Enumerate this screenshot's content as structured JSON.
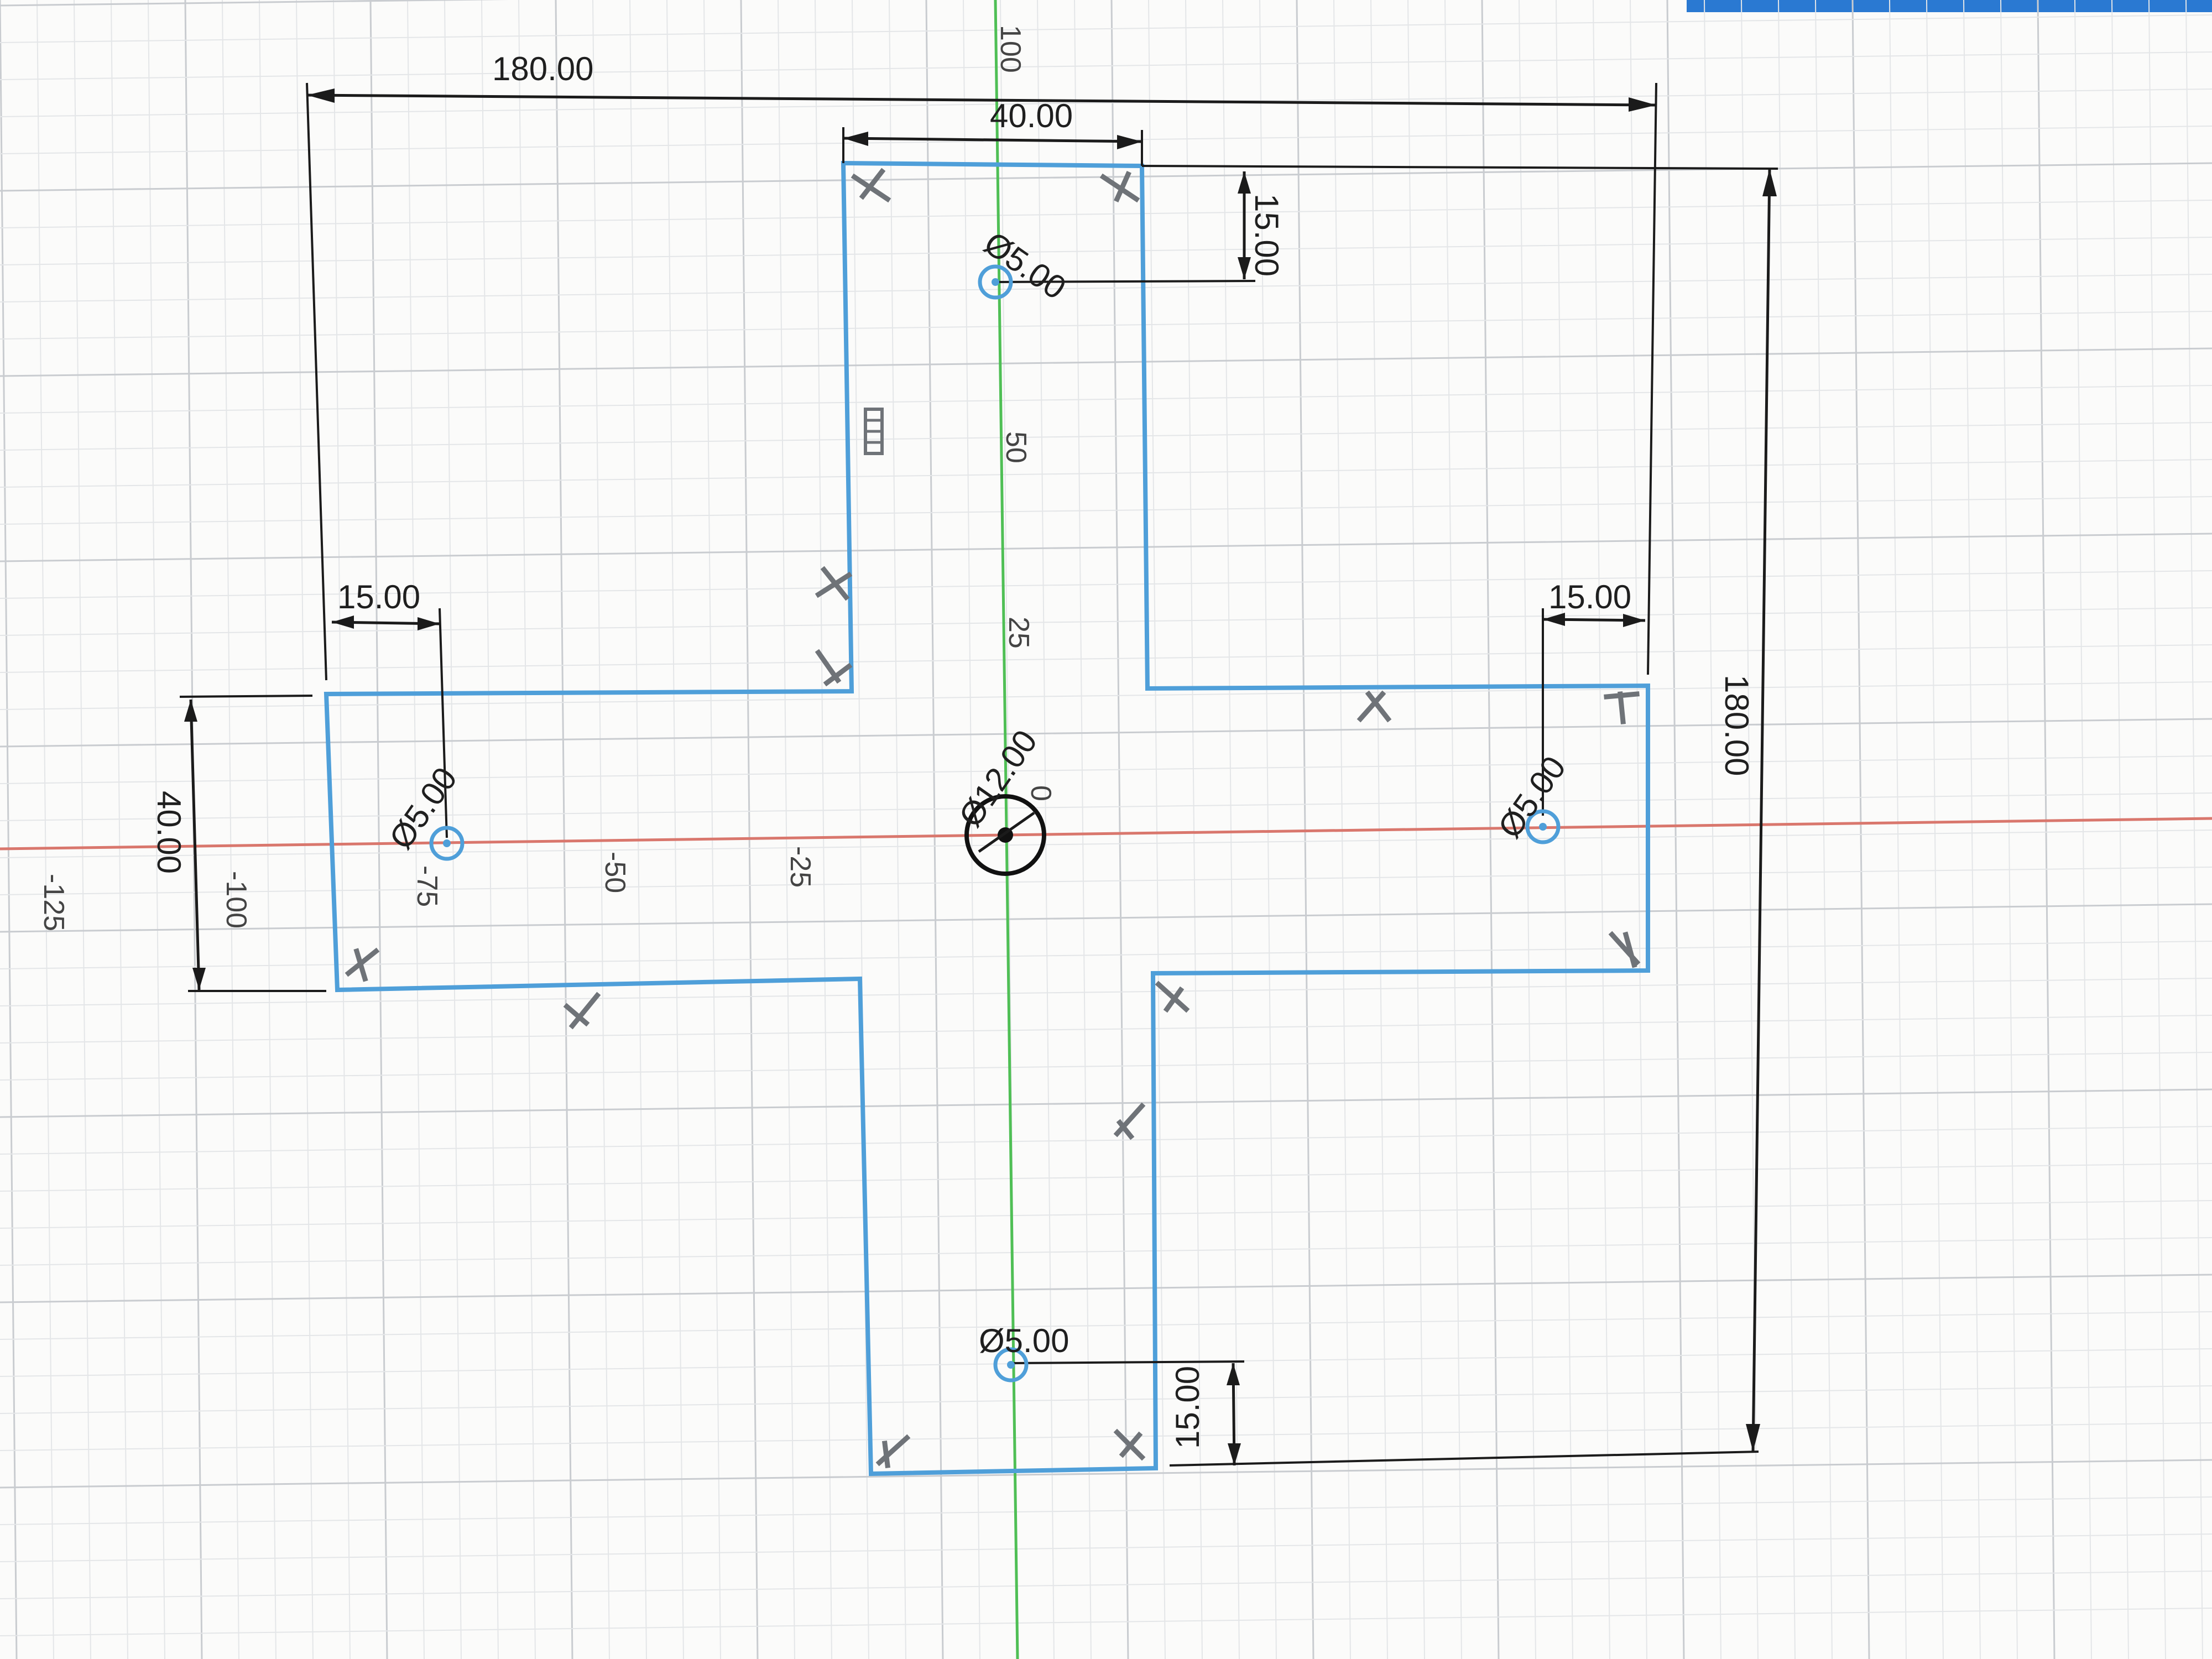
{
  "window": {
    "accent_color": "#2a79d2"
  },
  "colors": {
    "profile": "#4f9fd9",
    "x_axis": "#d9776d",
    "y_axis": "#4fbf55",
    "dimension": "#1b1b1b",
    "constraint": "#6f7378"
  },
  "dimensions": {
    "overall_width": "180.00",
    "overall_height": "180.00",
    "top_arm_width": "40.00",
    "top_hole_offset": "15.00",
    "bottom_hole_offset": "15.00",
    "left_hole_offset": "15.00",
    "right_hole_offset": "15.00",
    "left_arm_height": "40.00"
  },
  "holes": {
    "top": "Ø5.00",
    "left": "Ø5.00",
    "right": "Ø5.00",
    "bottom": "Ø5.00",
    "center": "Ø12.00"
  },
  "axis_labels": {
    "y_100": "100",
    "y_50": "50",
    "y_25": "25",
    "x_neg25": "-25",
    "x_neg50": "-50",
    "x_neg75": "-75",
    "x_neg100": "-100",
    "x_neg125": "-125",
    "origin_zero": "0"
  },
  "icons": {
    "constraint": "perpendicular-constraint-icon",
    "text_cursor": "text-edit-icon",
    "origin": "sketch-origin-icon"
  }
}
